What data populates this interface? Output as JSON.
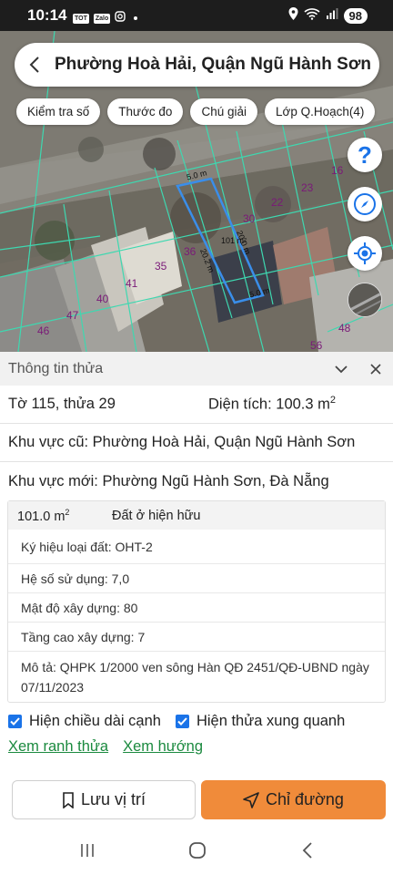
{
  "status_bar": {
    "time": "10:14",
    "app_icons": [
      "TOT",
      "Zalo",
      "instagram-icon"
    ],
    "battery": "98",
    "icons": [
      "location-icon",
      "wifi-icon",
      "signal-icon"
    ]
  },
  "map": {
    "title": "Phường Hoà Hải, Quận Ngũ Hành Sơn",
    "chips": [
      "Kiểm tra số",
      "Thước đo",
      "Chú giải",
      "Lớp Q.Hoạch(4)"
    ],
    "parcel_numbers": [
      "16",
      "23",
      "22",
      "30",
      "36",
      "35",
      "41",
      "40",
      "47",
      "46",
      "48",
      "56"
    ],
    "edge_labels": [
      "5.0 m",
      "20.2 m",
      "20.0 m",
      "5.0 m"
    ],
    "area_label": "101 m²",
    "boundary_color": "#3a8eea",
    "grid_color": "#3ed8b0"
  },
  "panel": {
    "header": "Thông tin thửa",
    "sheet_parcel": "Tờ 115, thửa 29",
    "area_label": "Diện tích: 100.3 m",
    "area_sup": "2",
    "old_region": "Khu vực cũ: Phường Hoà Hải, Quận Ngũ Hành Sơn",
    "new_region": "Khu vực mới: Phường Ngũ Hành Sơn, Đà Nẵng",
    "zone": {
      "area": "101.0 m",
      "area_sup": "2",
      "land_type": "Đất ở hiện hữu",
      "symbol": "Ký hiệu loại đất: OHT-2",
      "usage_ratio": "Hệ số sử dụng: 7,0",
      "density": "Mật độ xây dựng: 80",
      "floors": "Tầng cao xây dựng: 7",
      "description": "Mô tả: QHPK 1/2000 ven sông Hàn QĐ 2451/QĐ-UBND ngày 07/11/2023"
    },
    "checkbox_edges": "Hiện chiều dài cạnh",
    "checkbox_neighbors": "Hiện thửa xung quanh",
    "link_boundary": "Xem ranh thửa",
    "link_direction": "Xem hướng"
  },
  "actions": {
    "save": "Lưu vị trí",
    "route": "Chỉ đường",
    "route_color": "#f08b3a"
  }
}
